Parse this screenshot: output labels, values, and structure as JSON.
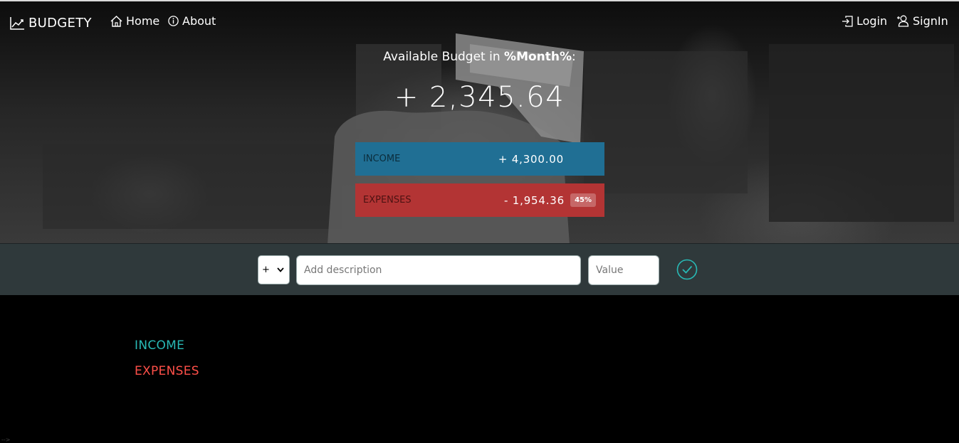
{
  "nav": {
    "brand": "BUDGETY",
    "home": "Home",
    "about": "About",
    "login": "Login",
    "signin": "SignIn"
  },
  "budget": {
    "title_prefix": "Available Budget in ",
    "month": "%Month%",
    "title_suffix": ":",
    "value": "+ 2,345.64",
    "income_label": "Income",
    "income_value": "+ 4,300.00",
    "expenses_label": "Expenses",
    "expenses_value": "- 1,954.36",
    "expenses_percentage": "45%"
  },
  "add": {
    "type_value": "+",
    "description_placeholder": "Add description",
    "value_placeholder": "Value"
  },
  "lists": {
    "income_title": "Income",
    "expenses_title": "Expenses"
  },
  "stray_text": "-->",
  "colors": {
    "income": "#28b9b5",
    "expenses": "#ff5049",
    "income_bar": "#206f94",
    "expenses_bar": "#b33434",
    "add_bar": "#2f393b"
  },
  "icons": {
    "brand": "chart-line-icon",
    "home": "house-icon",
    "about": "info-circle-icon",
    "login": "login-arrow-icon",
    "signin": "user-plus-icon",
    "add": "checkmark-circle-icon"
  }
}
